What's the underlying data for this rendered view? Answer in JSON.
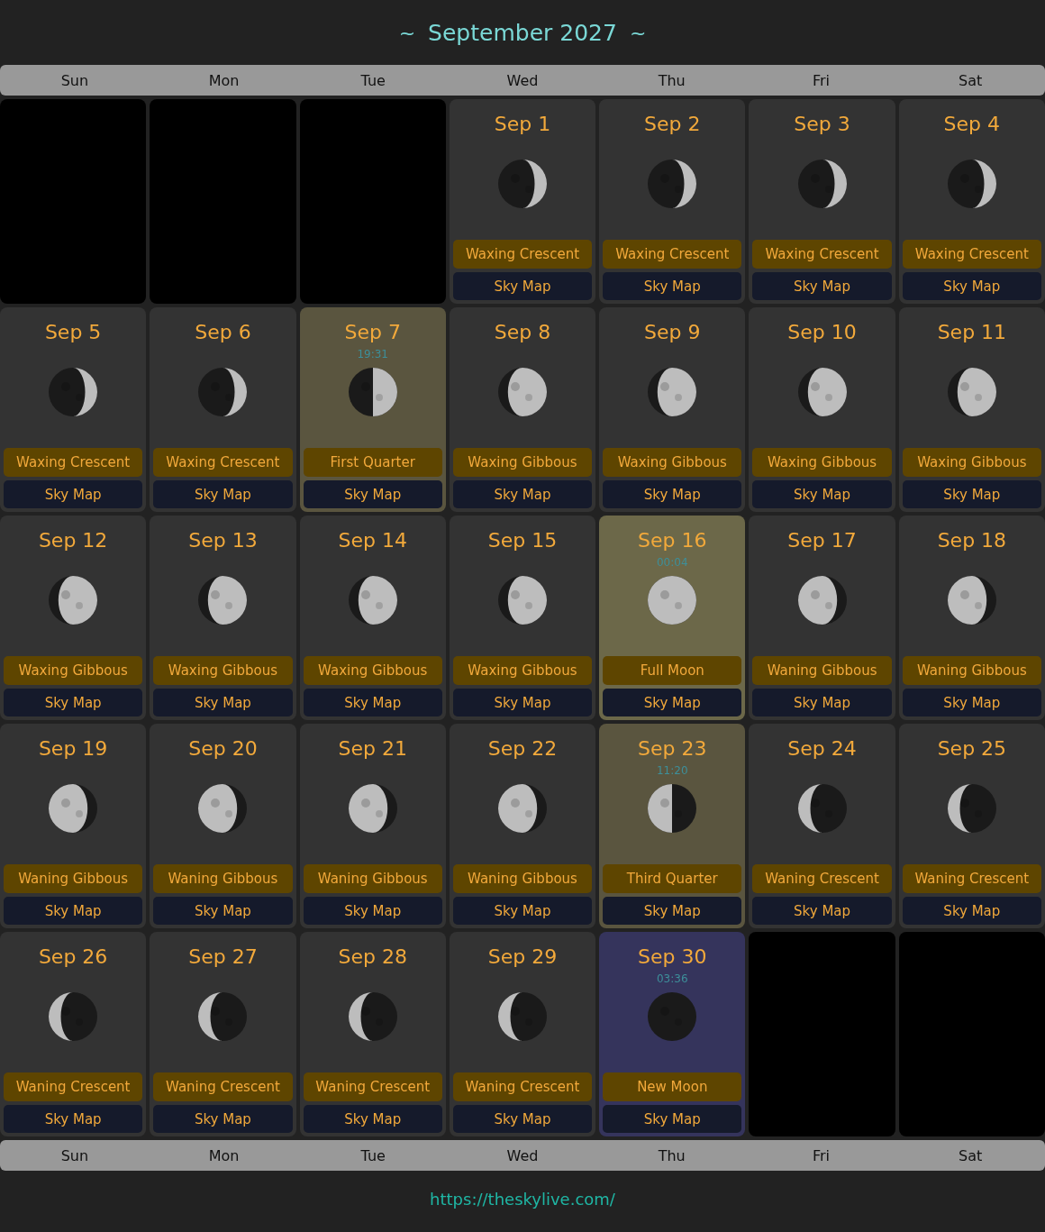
{
  "header": {
    "left_mark": "~",
    "title": "September 2027",
    "right_mark": "~"
  },
  "weekdays_top": [
    "Sun",
    "Mon",
    "Tue",
    "Wed",
    "Thu",
    "Fri",
    "Sat"
  ],
  "weeks": [
    [
      {
        "kind": "empty"
      },
      {
        "kind": "empty"
      },
      {
        "kind": "empty"
      },
      {
        "kind": "waxing_crescent",
        "date": "Sep 1",
        "color": "#333333",
        "phase": "Waxing Crescent",
        "link": "Sky Map"
      },
      {
        "kind": "waxing_crescent",
        "date": "Sep 2",
        "color": "#333333",
        "phase": "Waxing Crescent",
        "link": "Sky Map"
      },
      {
        "kind": "waxing_crescent",
        "date": "Sep 3",
        "color": "#333333",
        "phase": "Waxing Crescent",
        "link": "Sky Map"
      },
      {
        "kind": "waxing_crescent",
        "date": "Sep 4",
        "color": "#333333",
        "phase": "Waxing Crescent",
        "link": "Sky Map"
      }
    ],
    [
      {
        "kind": "waxing_crescent",
        "date": "Sep 5",
        "color": "#333333",
        "phase": "Waxing Crescent",
        "link": "Sky Map"
      },
      {
        "kind": "waxing_crescent",
        "date": "Sep 6",
        "color": "#333333",
        "phase": "Waxing Crescent",
        "link": "Sky Map"
      },
      {
        "kind": "first_quarter",
        "date": "Sep 7",
        "time": "19:31",
        "color": "#5a553f",
        "phase": "First Quarter",
        "link": "Sky Map"
      },
      {
        "kind": "waxing_gibbous",
        "date": "Sep 8",
        "color": "#333333",
        "phase": "Waxing Gibbous",
        "link": "Sky Map"
      },
      {
        "kind": "waxing_gibbous",
        "date": "Sep 9",
        "color": "#333333",
        "phase": "Waxing Gibbous",
        "link": "Sky Map"
      },
      {
        "kind": "waxing_gibbous",
        "date": "Sep 10",
        "color": "#333333",
        "phase": "Waxing Gibbous",
        "link": "Sky Map"
      },
      {
        "kind": "waxing_gibbous",
        "date": "Sep 11",
        "color": "#333333",
        "phase": "Waxing Gibbous",
        "link": "Sky Map"
      }
    ],
    [
      {
        "kind": "waxing_gibbous",
        "date": "Sep 12",
        "color": "#333333",
        "phase": "Waxing Gibbous",
        "link": "Sky Map"
      },
      {
        "kind": "waxing_gibbous",
        "date": "Sep 13",
        "color": "#333333",
        "phase": "Waxing Gibbous",
        "link": "Sky Map"
      },
      {
        "kind": "waxing_gibbous",
        "date": "Sep 14",
        "color": "#333333",
        "phase": "Waxing Gibbous",
        "link": "Sky Map"
      },
      {
        "kind": "waxing_gibbous",
        "date": "Sep 15",
        "color": "#333333",
        "phase": "Waxing Gibbous",
        "link": "Sky Map"
      },
      {
        "kind": "full",
        "date": "Sep 16",
        "time": "00:04",
        "color": "#6c6849",
        "phase": "Full Moon",
        "link": "Sky Map"
      },
      {
        "kind": "waning_gibbous",
        "date": "Sep 17",
        "color": "#333333",
        "phase": "Waning Gibbous",
        "link": "Sky Map"
      },
      {
        "kind": "waning_gibbous",
        "date": "Sep 18",
        "color": "#333333",
        "phase": "Waning Gibbous",
        "link": "Sky Map"
      }
    ],
    [
      {
        "kind": "waning_gibbous",
        "date": "Sep 19",
        "color": "#333333",
        "phase": "Waning Gibbous",
        "link": "Sky Map"
      },
      {
        "kind": "waning_gibbous",
        "date": "Sep 20",
        "color": "#333333",
        "phase": "Waning Gibbous",
        "link": "Sky Map"
      },
      {
        "kind": "waning_gibbous",
        "date": "Sep 21",
        "color": "#333333",
        "phase": "Waning Gibbous",
        "link": "Sky Map"
      },
      {
        "kind": "waning_gibbous",
        "date": "Sep 22",
        "color": "#333333",
        "phase": "Waning Gibbous",
        "link": "Sky Map"
      },
      {
        "kind": "third_quarter",
        "date": "Sep 23",
        "time": "11:20",
        "color": "#5a553f",
        "phase": "Third Quarter",
        "link": "Sky Map"
      },
      {
        "kind": "waning_crescent",
        "date": "Sep 24",
        "color": "#333333",
        "phase": "Waning Crescent",
        "link": "Sky Map"
      },
      {
        "kind": "waning_crescent",
        "date": "Sep 25",
        "color": "#333333",
        "phase": "Waning Crescent",
        "link": "Sky Map"
      }
    ],
    [
      {
        "kind": "waning_crescent",
        "date": "Sep 26",
        "color": "#333333",
        "phase": "Waning Crescent",
        "link": "Sky Map"
      },
      {
        "kind": "waning_crescent",
        "date": "Sep 27",
        "color": "#333333",
        "phase": "Waning Crescent",
        "link": "Sky Map"
      },
      {
        "kind": "waning_crescent",
        "date": "Sep 28",
        "color": "#333333",
        "phase": "Waning Crescent",
        "link": "Sky Map"
      },
      {
        "kind": "waning_crescent",
        "date": "Sep 29",
        "color": "#333333",
        "phase": "Waning Crescent",
        "link": "Sky Map"
      },
      {
        "kind": "new",
        "date": "Sep 30",
        "time": "03:36",
        "color": "#35345c",
        "phase": "New Moon",
        "link": "Sky Map"
      },
      {
        "kind": "empty"
      },
      {
        "kind": "empty"
      }
    ]
  ],
  "weekdays_bottom": [
    "Sun",
    "Mon",
    "Tue",
    "Wed",
    "Thu",
    "Fri",
    "Sat"
  ],
  "footer": {
    "link": "https://theskylive.com/"
  }
}
